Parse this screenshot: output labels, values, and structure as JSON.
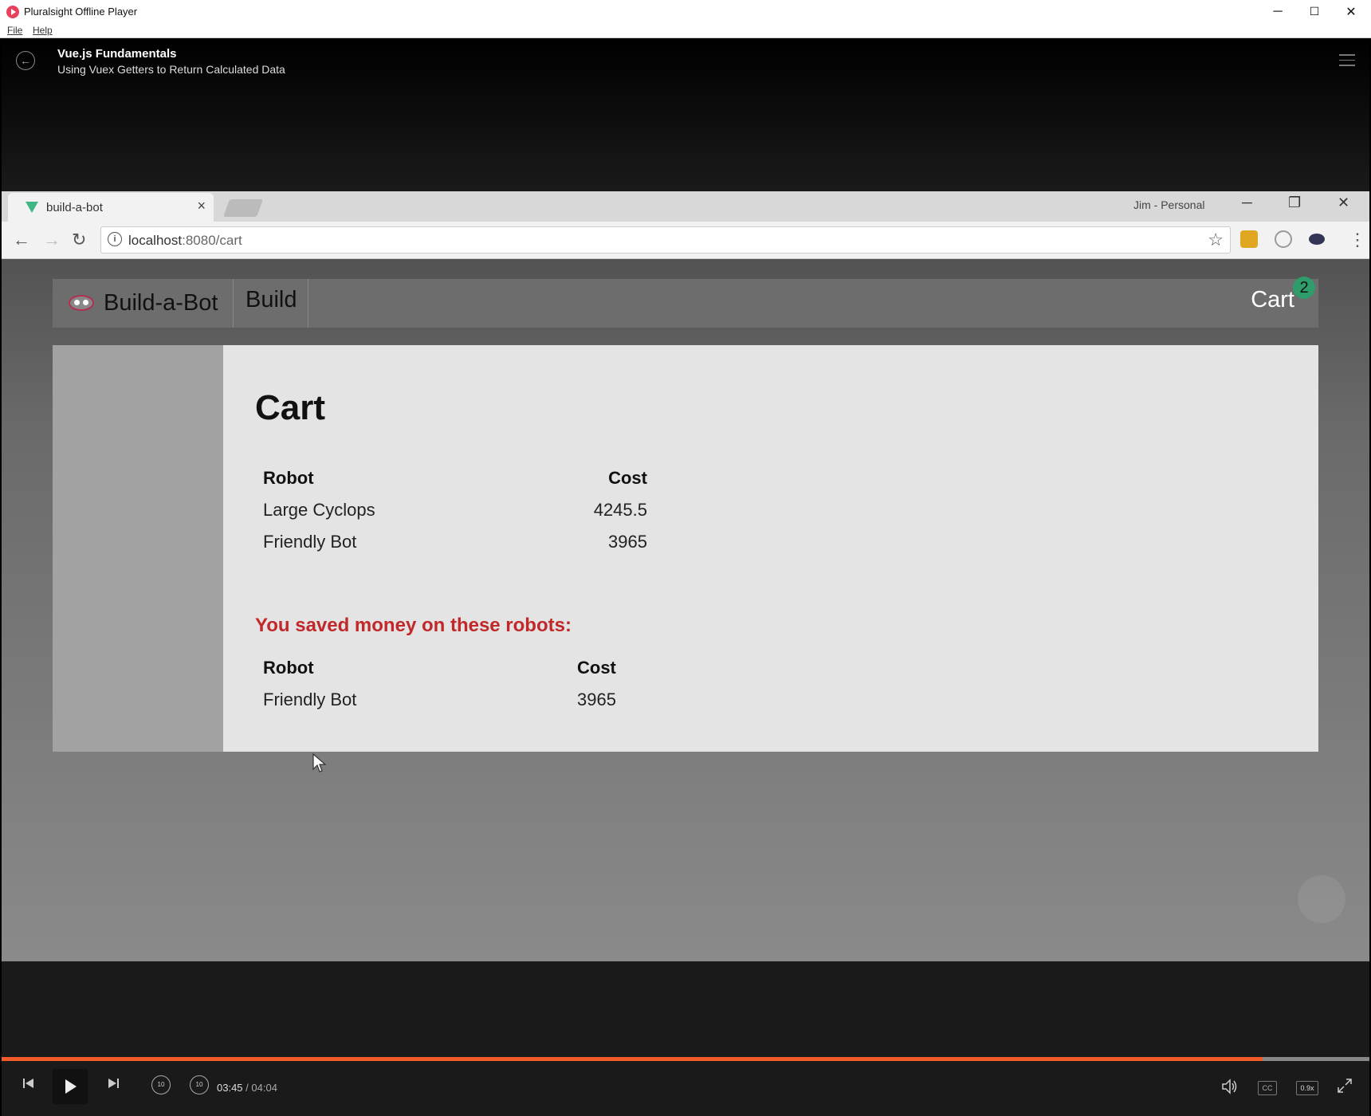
{
  "window": {
    "title": "Pluralsight Offline Player",
    "minimize": "─",
    "maximize": "☐",
    "close": "✕"
  },
  "menu": {
    "file": "File",
    "help": "Help"
  },
  "player": {
    "course_title": "Vue.js Fundamentals",
    "clip_title": "Using Vuex Getters to Return Calculated Data"
  },
  "browser": {
    "tab_label": "build-a-bot",
    "tab_close": "×",
    "profile": "Jim - Personal",
    "url_host": "localhost",
    "url_path": ":8080/cart",
    "back": "←",
    "forward": "→",
    "reload": "↻",
    "star": "☆",
    "kebab": "⋮",
    "min": "─",
    "restore": "❐",
    "close": "✕"
  },
  "site": {
    "brand": "Build-a-Bot",
    "nav_build": "Build",
    "nav_cart": "Cart",
    "cart_count": "2",
    "heading": "Cart",
    "cart_table": {
      "headers": [
        "Robot",
        "Cost"
      ],
      "rows": [
        [
          "Large Cyclops",
          "4245.5"
        ],
        [
          "Friendly Bot",
          "3965"
        ]
      ]
    },
    "saved_heading": "You saved money on these robots:",
    "saved_table": {
      "headers": [
        "Robot",
        "Cost"
      ],
      "rows": [
        [
          "Friendly Bot",
          "3965"
        ]
      ]
    }
  },
  "controls": {
    "current_time": "03:45",
    "separator": "/",
    "total_time": "04:04",
    "progress_fraction": 0.922,
    "speed": "0.9x",
    "cc": "CC",
    "rewind_label": "10",
    "forward_label": "10"
  },
  "colors": {
    "accent": "#f15b2a",
    "saved_text": "#c0282a",
    "badge": "#2e9c6b",
    "vue_green": "#41b883"
  }
}
